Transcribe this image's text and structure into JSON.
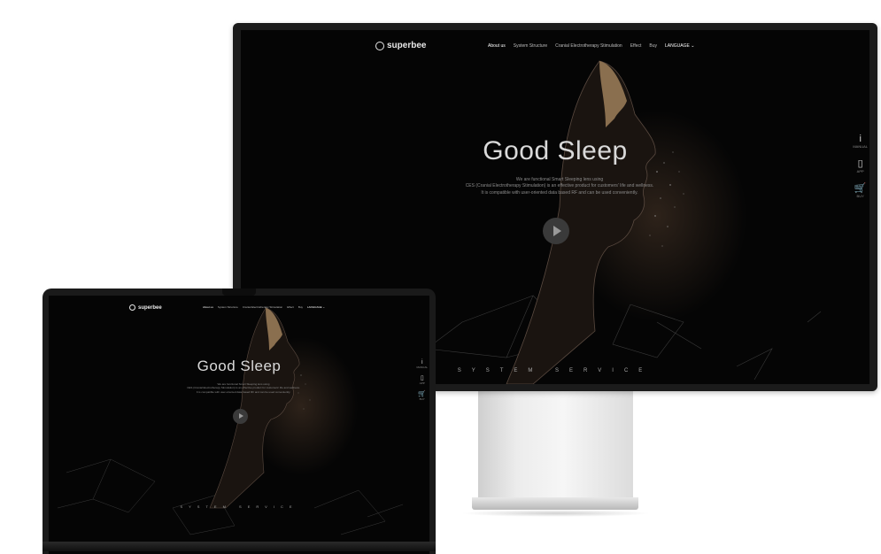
{
  "site": {
    "logo_text": "superbee",
    "nav": [
      "About us",
      "System Structure",
      "Cranial Electrotherapy Stimulation",
      "Effect",
      "Buy"
    ],
    "language_label": "LANGUAGE ⌄",
    "hero_title": "Good Sleep",
    "hero_desc_lines": [
      "We are functional Smart Sleeping lens using",
      "CES (Cranial Electrotherapy Stimulation) is an effective product for customers' life and wellness.",
      "It is compatible with user-oriented data based RF and can be used conveniently."
    ],
    "footer_text": "SYSTEM SERVICE",
    "side_menu": [
      {
        "glyph": "i",
        "label": "MANUAL"
      },
      {
        "glyph": "▯",
        "label": "APP"
      },
      {
        "glyph": "🛒",
        "label": "BUY"
      }
    ]
  },
  "colors": {
    "background": "#050505",
    "bezel": "#1b1b1b",
    "text": "#d9d9d9",
    "stand": "#e6e6e6"
  }
}
